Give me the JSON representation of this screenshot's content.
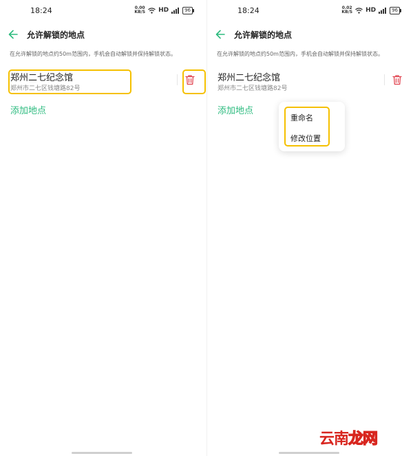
{
  "status_bar": {
    "time": "18:24",
    "net_speed_left": "0.00",
    "net_speed_right": "0.02",
    "net_unit": "KB/S",
    "hd_label": "HD",
    "battery": "96"
  },
  "header": {
    "title": "允许解锁的地点",
    "back_icon": "back-arrow-icon"
  },
  "description": "在允许解锁的地点约50m范围内，手机会自动解锁并保持解锁状态。",
  "location": {
    "name": "郑州二七纪念馆",
    "address": "郑州市二七区钱塘路82号"
  },
  "add_location_label": "添加地点",
  "context_menu": {
    "items": [
      "重命名",
      "修改位置"
    ]
  },
  "watermark": {
    "part1": "云南",
    "part2": "龙网"
  },
  "colors": {
    "accent": "#2dbb7f",
    "delete": "#e0424e",
    "highlight": "#f5c000"
  }
}
